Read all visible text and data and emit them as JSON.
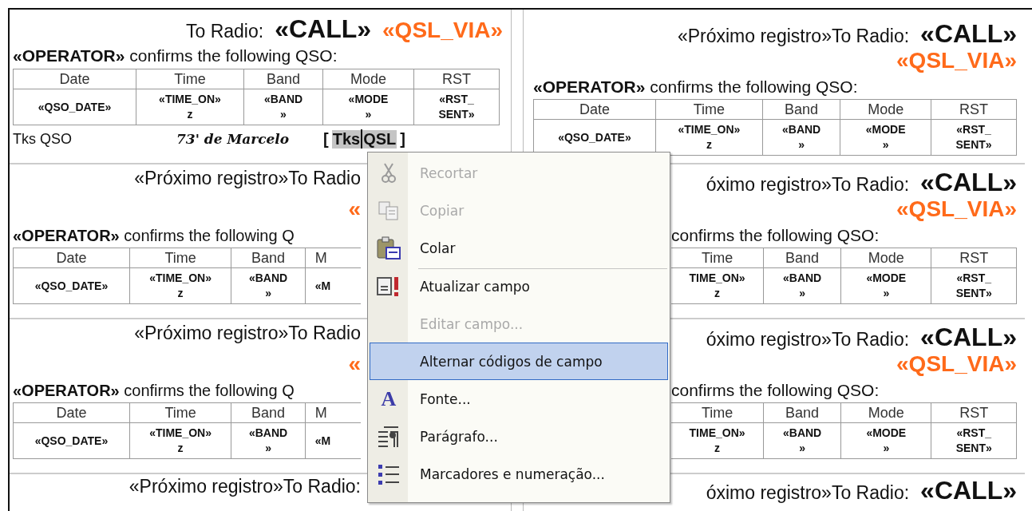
{
  "left_labels": [
    {
      "kind": "first",
      "heading": "To Radio:",
      "call": "«CALL»",
      "qsl_via": "«QSL_VIA»",
      "operator_line": "**«OPERATOR»** confirms the following QSO:",
      "columns": [
        "Date",
        "Time",
        "Band",
        "Mode",
        "RST"
      ],
      "cells": [
        [
          "«QSO_DATE»"
        ],
        [
          "«TIME_ON»",
          "z"
        ],
        [
          "«BAND",
          "»"
        ],
        [
          "«MODE",
          "»"
        ],
        [
          "«RST_",
          "SENT»"
        ]
      ],
      "footer": {
        "label": "Tks QSO",
        "signature": "73' de Marcelo",
        "bracket_open": "[",
        "field_parts": [
          "Tks",
          "QSL"
        ],
        "bracket_close": "]"
      }
    },
    {
      "kind": "cut_right",
      "heading": "«Próximo registro»To Radio",
      "qsl_via": "«",
      "operator_line": "**«OPERATOR»** confirms the following Q",
      "columns": [
        "Date",
        "Time",
        "Band",
        "M"
      ],
      "cells": [
        [
          "«QSO_DATE»"
        ],
        [
          "«TIME_ON»",
          "z"
        ],
        [
          "«BAND",
          "»"
        ],
        [
          "«M"
        ]
      ]
    },
    {
      "kind": "cut_right",
      "heading": "«Próximo registro»To Radio",
      "qsl_via": "«",
      "operator_line": "**«OPERATOR»** confirms the following Q",
      "columns": [
        "Date",
        "Time",
        "Band",
        "M"
      ],
      "cells": [
        [
          "«QSO_DATE»"
        ],
        [
          "«TIME_ON»",
          "z"
        ],
        [
          "«BAND",
          "»"
        ],
        [
          "«M"
        ]
      ]
    },
    {
      "kind": "stub_cut_right",
      "heading": "«Próximo registro»To Radio:"
    }
  ],
  "right_labels": [
    {
      "kind": "record",
      "heading": "«Próximo registro»To Radio:",
      "call": "«CALL»",
      "qsl_via": "«QSL_VIA»",
      "operator_line": "**«OPERATOR»** confirms the following QSO:",
      "columns": [
        "Date",
        "Time",
        "Band",
        "Mode",
        "RST"
      ],
      "cells": [
        [
          "«QSO_DATE»"
        ],
        [
          "«TIME_ON»",
          "z"
        ],
        [
          "«BAND",
          "»"
        ],
        [
          "«MODE",
          "»"
        ],
        [
          "«RST_",
          "SENT»"
        ]
      ]
    },
    {
      "kind": "cut_left",
      "heading": "óximo registro»To Radio:",
      "call": "«CALL»",
      "qsl_via": "«QSL_VIA»",
      "operator_line": "confirms the following QSO:",
      "columns": [
        "Time",
        "Band",
        "Mode",
        "RST"
      ],
      "cells": [
        [
          "TIME_ON»",
          "z"
        ],
        [
          "«BAND",
          "»"
        ],
        [
          "«MODE",
          "»"
        ],
        [
          "«RST_",
          "SENT»"
        ]
      ]
    },
    {
      "kind": "cut_left",
      "heading": "óximo registro»To Radio:",
      "call": "«CALL»",
      "qsl_via": "«QSL_VIA»",
      "operator_line": "confirms the following QSO:",
      "columns": [
        "Time",
        "Band",
        "Mode",
        "RST"
      ],
      "cells": [
        [
          "TIME_ON»",
          "z"
        ],
        [
          "«BAND",
          "»"
        ],
        [
          "«MODE",
          "»"
        ],
        [
          "«RST_",
          "SENT»"
        ]
      ]
    },
    {
      "kind": "stub_cut_left",
      "heading": "óximo registro»To Radio:",
      "call": "«CALL»"
    }
  ],
  "context_menu": {
    "items": [
      {
        "label": "Recortar",
        "disabled": true,
        "selected": false,
        "separator_before": false
      },
      {
        "label": "Copiar",
        "disabled": true,
        "selected": false,
        "separator_before": false
      },
      {
        "label": "Colar",
        "disabled": false,
        "selected": false,
        "separator_before": false
      },
      {
        "label": "Atualizar campo",
        "disabled": false,
        "selected": false,
        "separator_before": true
      },
      {
        "label": "Editar campo...",
        "disabled": true,
        "selected": false,
        "separator_before": false
      },
      {
        "label": "Alternar códigos de campo",
        "disabled": false,
        "selected": true,
        "separator_before": false
      },
      {
        "label": "Fonte...",
        "glyph": "A",
        "disabled": false,
        "selected": false,
        "separator_before": false
      },
      {
        "label": "Parágrafo...",
        "disabled": false,
        "selected": false,
        "separator_before": false
      },
      {
        "label": "Marcadores e numeração...",
        "disabled": false,
        "selected": false,
        "separator_before": false
      }
    ]
  }
}
